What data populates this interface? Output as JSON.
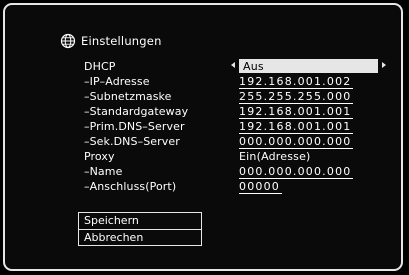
{
  "header": {
    "title": "Einstellungen",
    "icon": "globe-icon"
  },
  "settings": [
    {
      "label": "DHCP",
      "value": "Aus"
    },
    {
      "label": "–IP–Adresse",
      "value": "192.168.001.002"
    },
    {
      "label": "–Subnetzmaske",
      "value": "255.255.255.000"
    },
    {
      "label": "–Standardgateway",
      "value": "192.168.001.001"
    },
    {
      "label": "–Prim.DNS–Server",
      "value": "192.168.001.001"
    },
    {
      "label": "–Sek.DNS–Server",
      "value": "000.000.000.000"
    },
    {
      "label": "Proxy",
      "value": "Ein(Adresse)"
    },
    {
      "label": "–Name",
      "value": "000.000.000.000"
    },
    {
      "label": "–Anschluss(Port)",
      "value": "00000"
    }
  ],
  "actions": {
    "save": "Speichern",
    "cancel": "Abbrechen"
  },
  "colors": {
    "background": "#000000",
    "foreground": "#ffffff",
    "highlight": "#e6e6e6"
  }
}
